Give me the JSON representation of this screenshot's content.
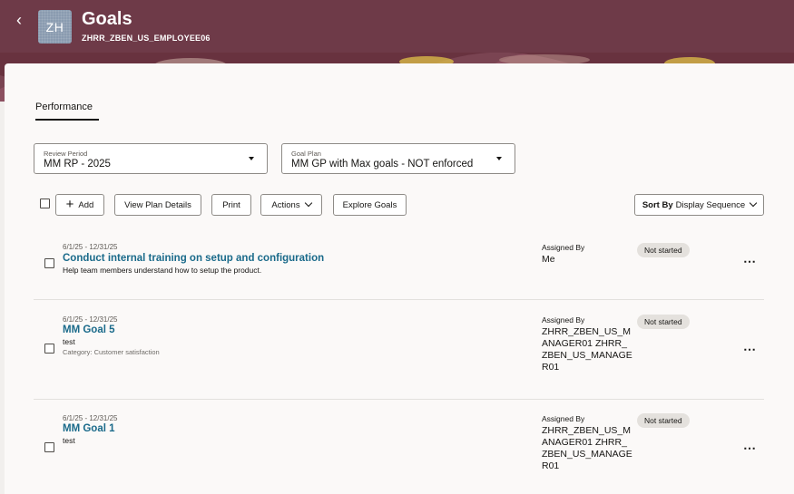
{
  "header": {
    "back_icon": "chevron-left-icon",
    "avatar_initials": "ZH",
    "title": "Goals",
    "subtitle": "ZHRR_ZBEN_US_EMPLOYEE06",
    "bg_color": "#6e3a48"
  },
  "tabs": [
    {
      "label": "Performance",
      "selected": true
    }
  ],
  "filters": {
    "review_period": {
      "label": "Review Period",
      "value": "MM RP - 2025"
    },
    "goal_plan": {
      "label": "Goal Plan",
      "value": "MM GP with Max goals - NOT enforced"
    }
  },
  "toolbar": {
    "add_label": "Add",
    "view_plan_label": "View Plan Details",
    "print_label": "Print",
    "actions_label": "Actions",
    "explore_label": "Explore Goals",
    "sort_prefix": "Sort By",
    "sort_value": "Display Sequence"
  },
  "goals": [
    {
      "dates": "6/1/25 - 12/31/25",
      "name": "Conduct internal training on setup and configuration",
      "description": "Help team members understand how to setup the product.",
      "category": "",
      "assigned_label": "Assigned By",
      "assigned_by": "Me",
      "status": "Not started"
    },
    {
      "dates": "6/1/25 - 12/31/25",
      "name": "MM Goal 5",
      "description": "test",
      "category": "Category: Customer satisfaction",
      "assigned_label": "Assigned By",
      "assigned_by": "ZHRR_ZBEN_US_MANAGER01 ZHRR_ZBEN_US_MANAGER01",
      "status": "Not started"
    },
    {
      "dates": "6/1/25 - 12/31/25",
      "name": "MM Goal 1",
      "description": "test",
      "category": "",
      "assigned_label": "Assigned By",
      "assigned_by": "ZHRR_ZBEN_US_MANAGER01 ZHRR_ZBEN_US_MANAGER01",
      "status": "Not started"
    }
  ]
}
